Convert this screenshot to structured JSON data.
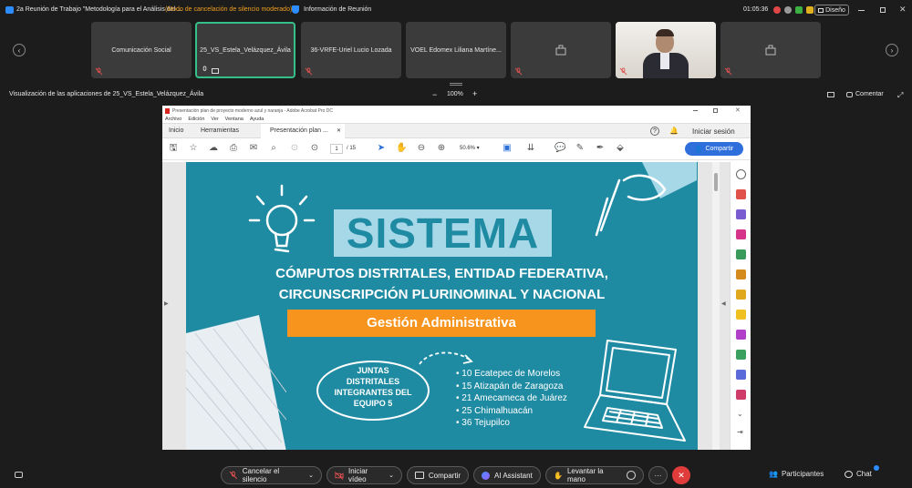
{
  "titlebar": {
    "meeting_title": "2a Reunión de Trabajo \"Metodología para el Análisis del ...",
    "mode": "(Modo de cancelación de silencio moderado)",
    "info_label": "Información de Reunión",
    "timer": "01:05:36",
    "layout_label": "Diseño"
  },
  "gallery": {
    "tiles": [
      {
        "name": "Comunicación Social"
      },
      {
        "name": "25_VS_Estela_Velázquez_Ávila"
      },
      {
        "name": "36-VRFE-Uriel Lucio Lozada"
      },
      {
        "name": "VOEL Edomex Liliana Martíne..."
      }
    ]
  },
  "sharebar": {
    "label": "Visualización de las aplicaciones de 25_VS_Estela_Velázquez_Ávila",
    "zoom_minus": "−",
    "zoom": "100%",
    "zoom_plus": "+",
    "comment": "Comentar"
  },
  "acrobat": {
    "title": "Presentación plan de proyecto moderno azul y naranja - Adobe Acrobat Pro DC",
    "menu": [
      "Archivo",
      "Edición",
      "Ver",
      "Ventana",
      "Ayuda"
    ],
    "tabs": {
      "home": "Inicio",
      "tools": "Herramientas",
      "doc": "Presentación plan ..."
    },
    "signin": "Iniciar sesión",
    "page_current": "1",
    "page_total": "/ 15",
    "zoom": "50.6%",
    "share": "Compartir"
  },
  "slide": {
    "title": "SISTEMA",
    "subtitle1": "CÓMPUTOS DISTRITALES, ENTIDAD FEDERATIVA,",
    "subtitle2": "CIRCUNSCRIPCIÓN PLURINOMINAL Y NACIONAL",
    "banner": "Gestión Administrativa",
    "juntas": [
      "JUNTAS",
      "DISTRITALES",
      "INTEGRANTES DEL",
      "EQUIPO 5"
    ],
    "districts": [
      "10 Ecatepec de Morelos",
      "15 Atizapán de Zaragoza",
      "21 Amecameca de Juárez",
      "25 Chimalhuacán",
      "36 Tejupilco"
    ]
  },
  "bottombar": {
    "mute": "Cancelar el silencio",
    "video": "Iniciar vídeo",
    "share": "Compartir",
    "assistant": "AI Assistant",
    "raise": "Levantar la mano",
    "more": "···",
    "participants": "Participantes",
    "chat": "Chat"
  },
  "colors": {
    "slide_bg": "#1f8ba3",
    "banner": "#f7941d",
    "title_box": "#a7d8e8",
    "end_button": "#e03c3c",
    "share_button": "#2f6fdb"
  }
}
